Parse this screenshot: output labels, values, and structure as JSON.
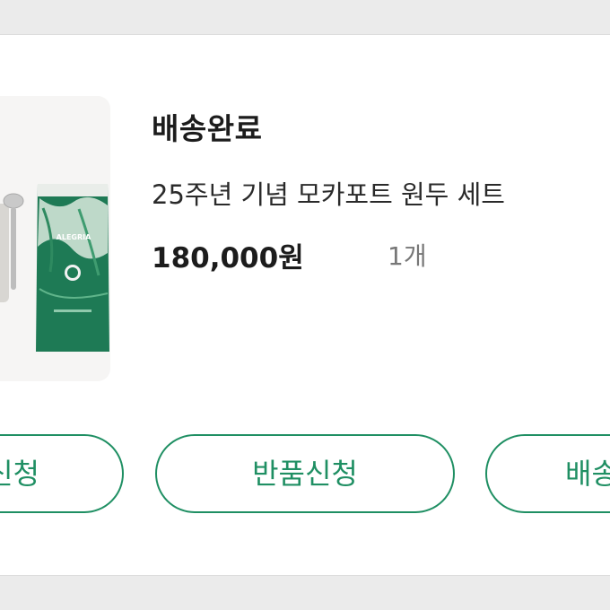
{
  "order": {
    "status": "배송완료",
    "product_name": "25주년 기념 모카포트 원두 세트",
    "price": "180,000원",
    "quantity": "1개",
    "image": "product-thumbnail (coffee bean bag and scoop)",
    "bag_text": "ALEGRIA"
  },
  "actions": {
    "left_label": "신청",
    "middle_label": "반품신청",
    "right_label": "배송"
  },
  "colors": {
    "accent": "#1f8f63",
    "bag_green": "#1e7a55",
    "text_primary": "#1c1c1c",
    "text_secondary": "#777777",
    "background": "#ebebeb",
    "card": "#ffffff"
  }
}
